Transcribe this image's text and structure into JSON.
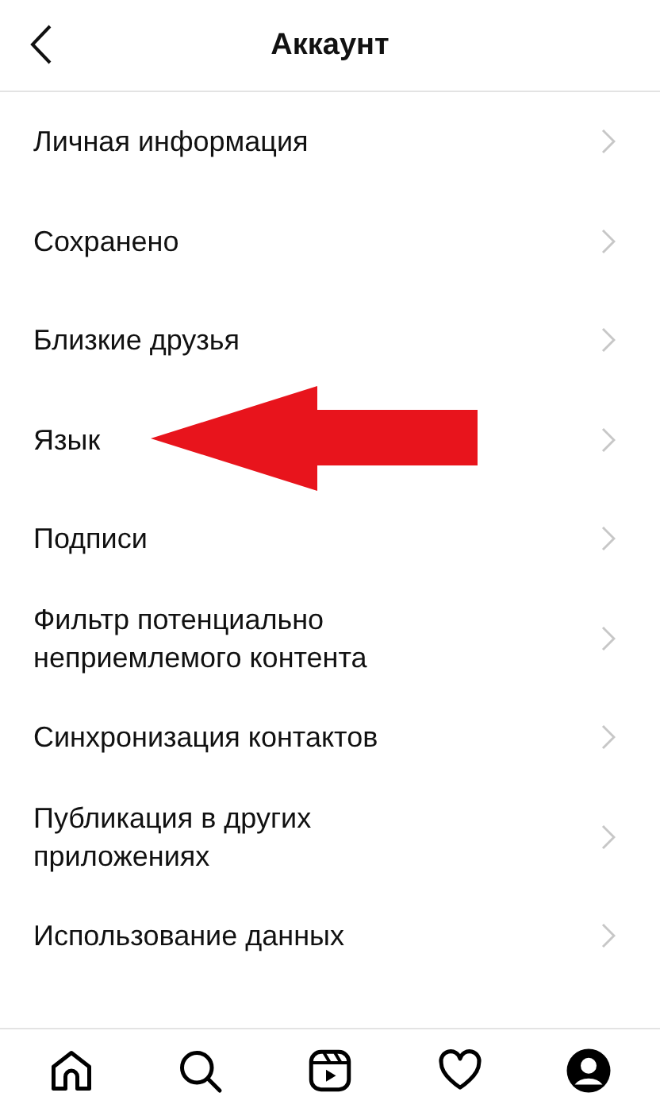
{
  "header": {
    "title": "Аккаунт"
  },
  "items": [
    {
      "label": "Личная информация"
    },
    {
      "label": "Сохранено"
    },
    {
      "label": "Близкие друзья"
    },
    {
      "label": "Язык"
    },
    {
      "label": "Подписи"
    },
    {
      "label": "Фильтр потенциально неприемлемого контента"
    },
    {
      "label": "Синхронизация контактов"
    },
    {
      "label": "Публикация в других приложениях"
    },
    {
      "label": "Использование данных"
    }
  ],
  "tab_bar": [
    {
      "kind": "home",
      "selected": false
    },
    {
      "kind": "search",
      "selected": false
    },
    {
      "kind": "reels",
      "selected": false
    },
    {
      "kind": "heart",
      "selected": false
    },
    {
      "kind": "profile",
      "selected": true
    }
  ]
}
